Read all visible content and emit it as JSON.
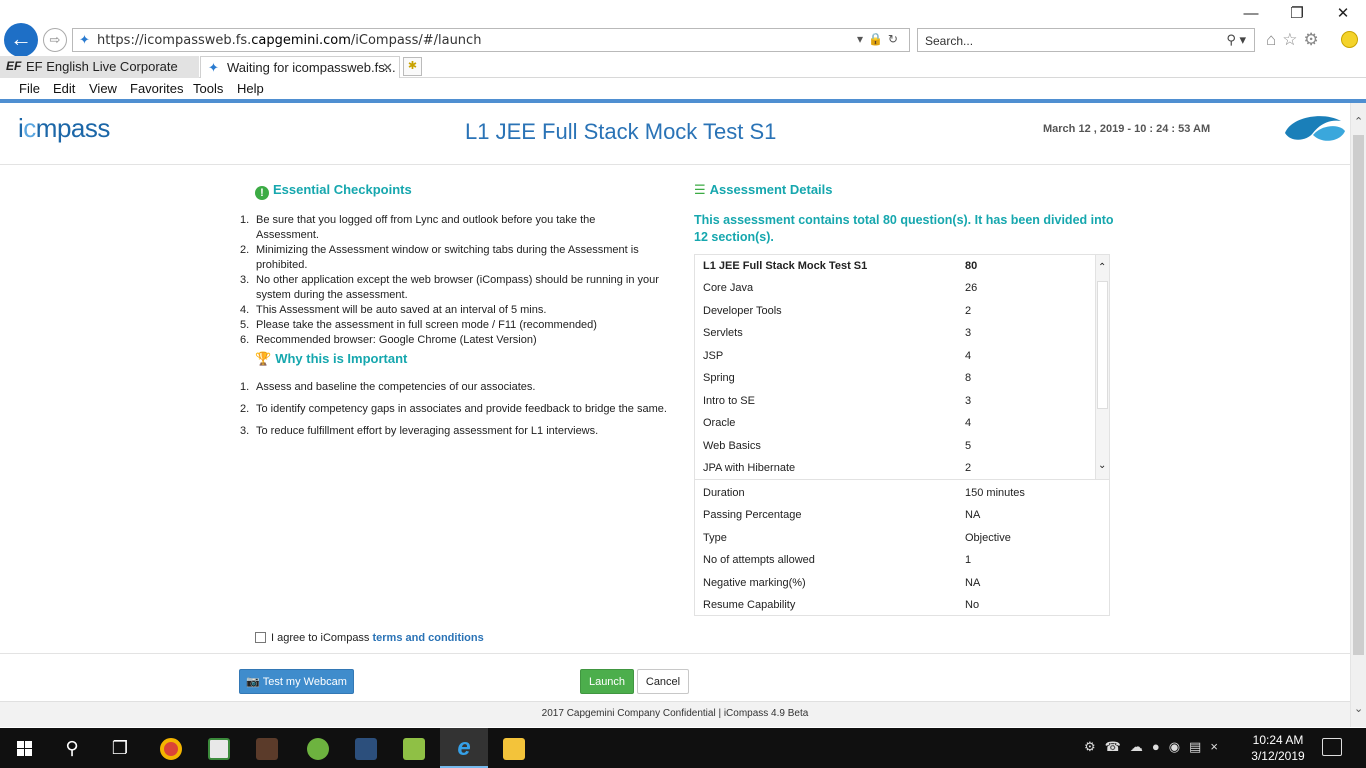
{
  "browser": {
    "url_prefix": "https://icompassweb.fs.",
    "url_domain": "capgemini.com",
    "url_suffix": "/iCompass/#/launch",
    "search_placeholder": "Search...",
    "tabs": [
      {
        "label": "EF English Live Corporate",
        "logo": "EF"
      },
      {
        "label": "Waiting for icompassweb.fs..."
      }
    ],
    "menu": [
      "File",
      "Edit",
      "View",
      "Favorites",
      "Tools",
      "Help"
    ]
  },
  "header": {
    "logo_pre": "i",
    "logo_c": "c",
    "logo_post": "mpass",
    "title": "L1 JEE Full Stack Mock Test S1",
    "datetime": "March 12 , 2019 - 10 : 24 : 53 AM"
  },
  "checkpoints": {
    "heading": "Essential Checkpoints",
    "items": [
      "Be sure that you logged off from Lync and outlook before you take the Assessment.",
      "Minimizing the Assessment window or switching tabs during the Assessment is prohibited.",
      "No other application except the web browser (iCompass) should be running in your system during the assessment.",
      "This Assessment will be auto saved at an interval of 5 mins.",
      "Please take the assessment in full screen mode / F11 (recommended)",
      "Recommended browser: Google Chrome (Latest Version)"
    ]
  },
  "importance": {
    "heading": "Why this is Important",
    "items": [
      "Assess and baseline the competencies of our associates.",
      "To identify competency gaps in associates and provide feedback to bridge the same.",
      "To reduce fulfillment effort by leveraging assessment for L1 interviews."
    ]
  },
  "assessment": {
    "heading": "Assessment Details",
    "intro": "This assessment contains total 80 question(s). It has been divided into 12 section(s).",
    "sections": [
      {
        "name": "L1 JEE Full Stack Mock Test S1",
        "count": "80"
      },
      {
        "name": "Core Java",
        "count": "26"
      },
      {
        "name": "Developer Tools",
        "count": "2"
      },
      {
        "name": "Servlets",
        "count": "3"
      },
      {
        "name": "JSP",
        "count": "4"
      },
      {
        "name": "Spring",
        "count": "8"
      },
      {
        "name": "Intro to SE",
        "count": "3"
      },
      {
        "name": "Oracle",
        "count": "4"
      },
      {
        "name": "Web Basics",
        "count": "5"
      },
      {
        "name": "JPA with Hibernate",
        "count": "2"
      }
    ],
    "meta": [
      {
        "key": "Duration",
        "value": "150 minutes"
      },
      {
        "key": "Passing Percentage",
        "value": "NA"
      },
      {
        "key": "Type",
        "value": "Objective"
      },
      {
        "key": "No of attempts allowed",
        "value": "1"
      },
      {
        "key": "Negative marking(%)",
        "value": "NA"
      },
      {
        "key": "Resume Capability",
        "value": "No"
      }
    ]
  },
  "agreement": {
    "text": "I agree to iCompass ",
    "link": "terms and conditions",
    "checked": false
  },
  "buttons": {
    "webcam": "Test my Webcam",
    "launch": "Launch",
    "cancel": "Cancel"
  },
  "footer": {
    "copyright": "2017 Capgemini Company Confidential | iCompass 4.9 Beta"
  },
  "taskbar": {
    "time": "10:24 AM",
    "date": "3/12/2019"
  },
  "colors": {
    "accent_teal": "#16a7ae",
    "title_blue": "#2a73b6",
    "launch_green": "#4cae4c",
    "webcam_blue": "#3f8ccc"
  }
}
